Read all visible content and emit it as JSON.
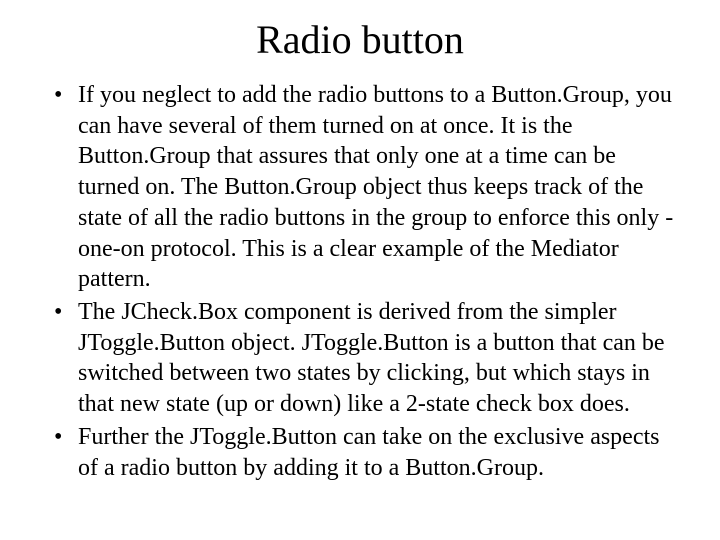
{
  "slide": {
    "title": "Radio button",
    "bullets": [
      "If you neglect to add the radio buttons to a Button.Group, you can have several of them turned on at once. It is the Button.Group that assures that only one at a time can be turned on. The Button.Group object thus keeps track of the state of all the radio buttons in the group to enforce this only -one-on protocol. This is a clear example of the Mediator pattern.",
      "The JCheck.Box component is derived from the simpler JToggle.Button object. JToggle.Button is a button that can be switched between two states by clicking, but which stays in that new state (up or down) like a 2-state check box does.",
      "Further the JToggle.Button can take on the exclusive aspects of a radio button by adding it to a Button.Group."
    ]
  }
}
